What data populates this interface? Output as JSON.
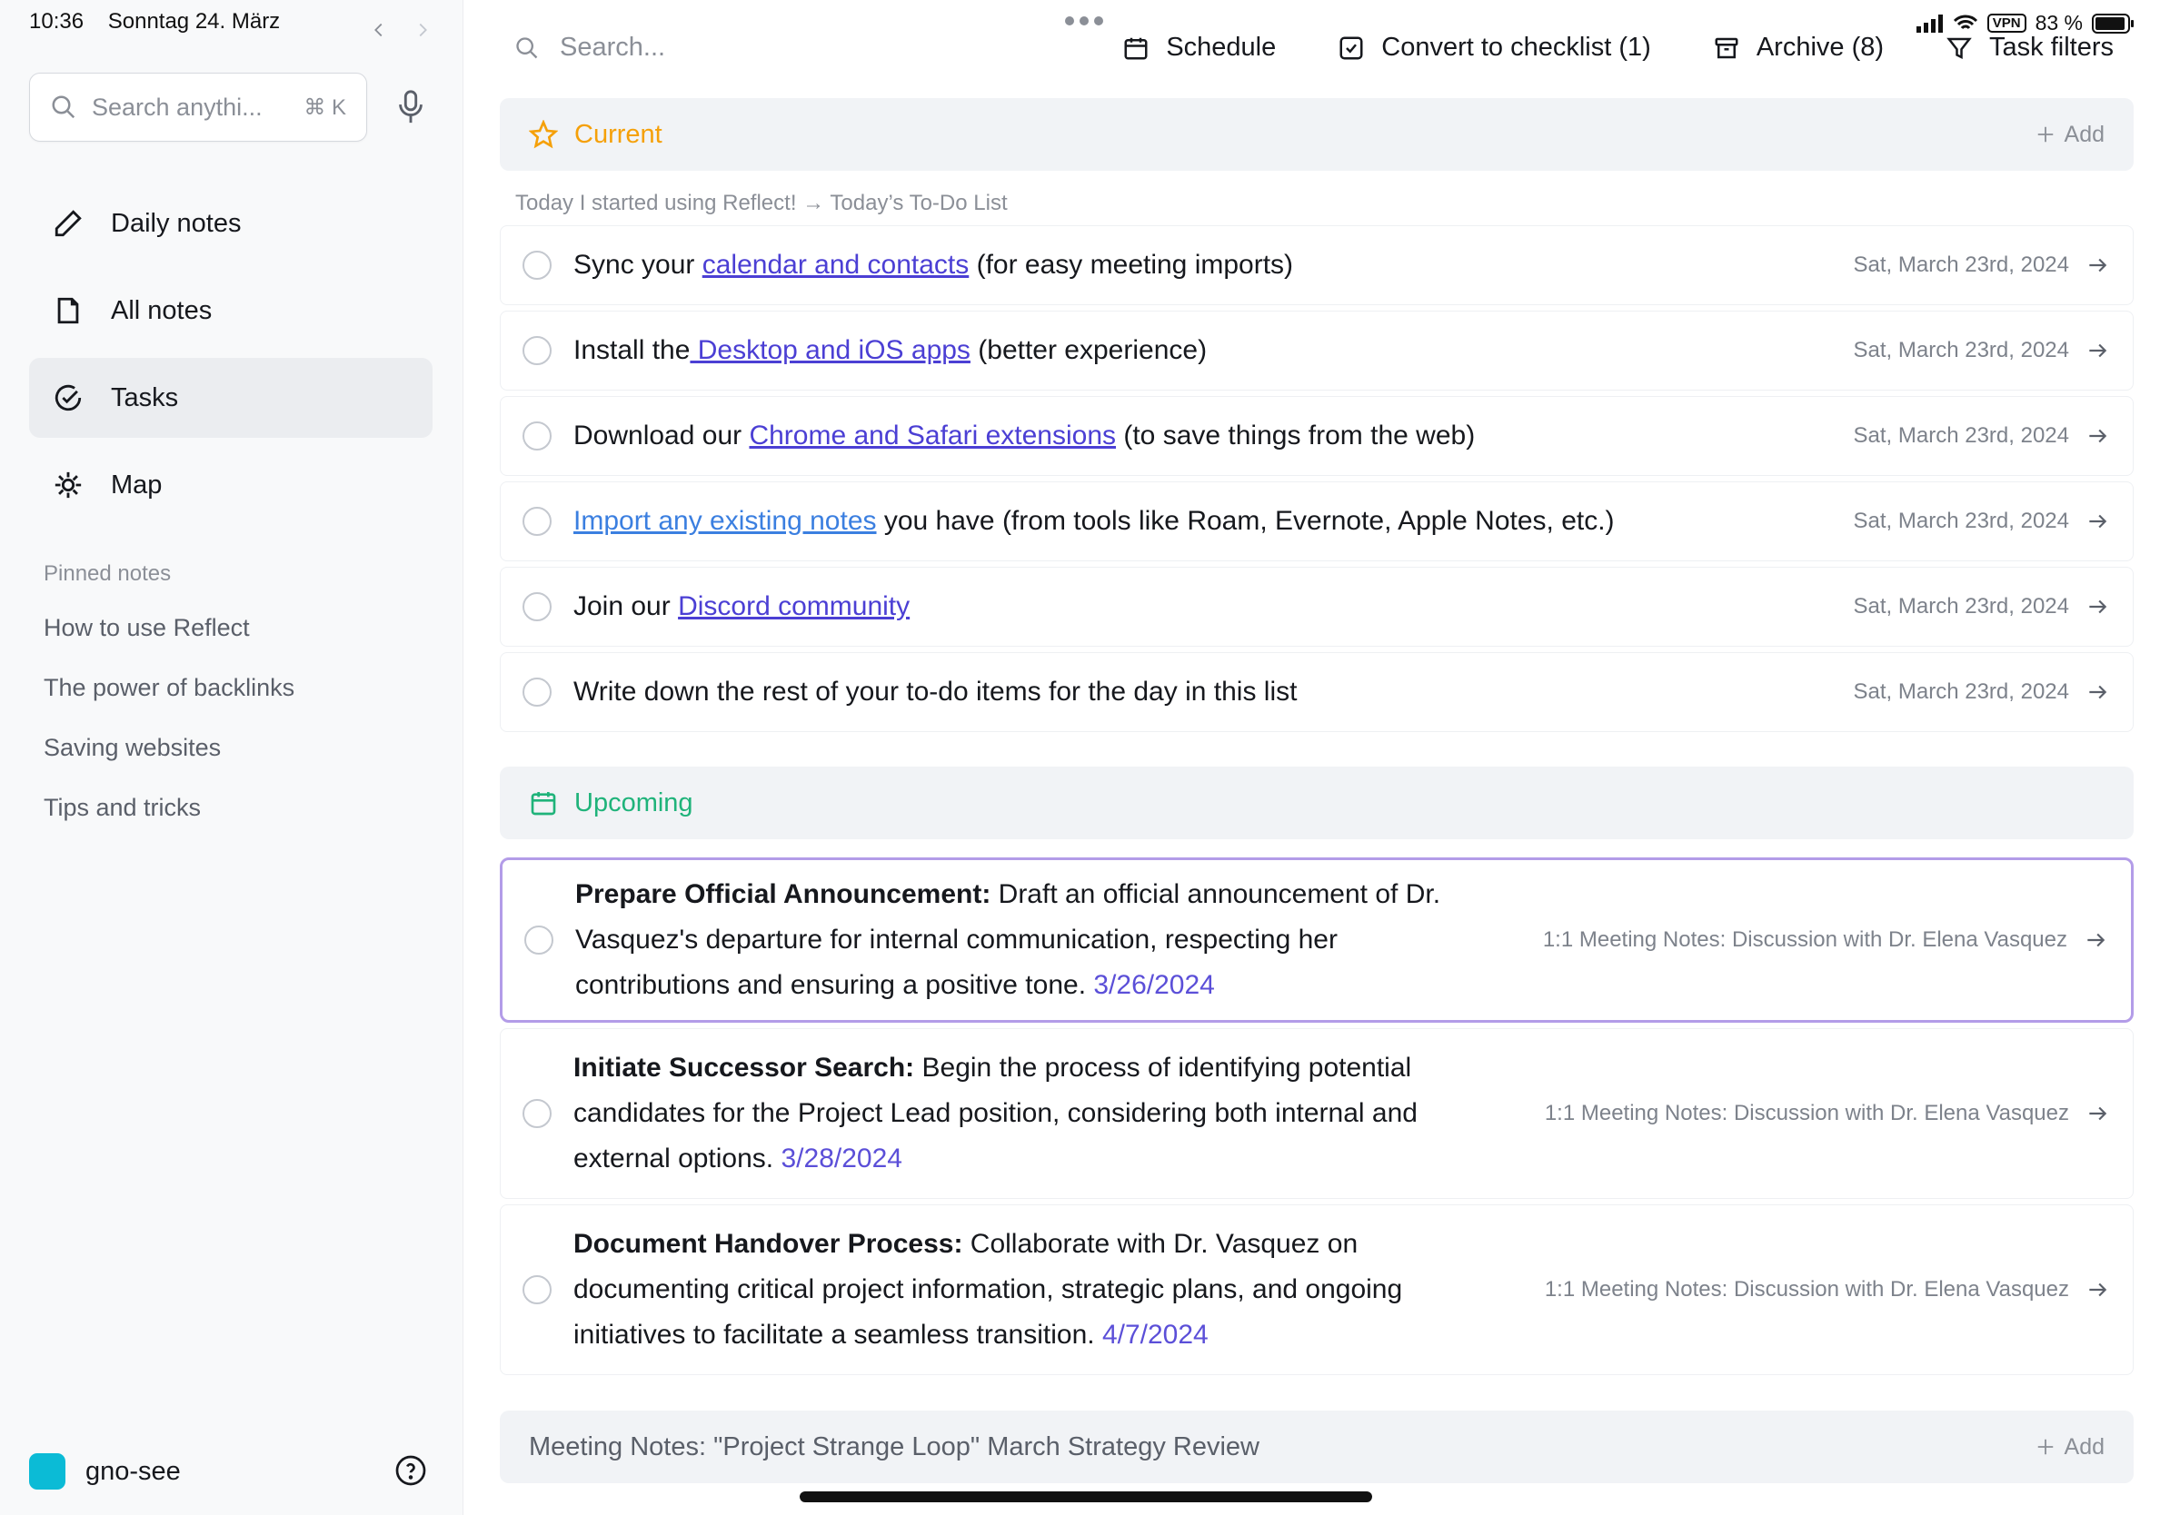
{
  "status_bar": {
    "time": "10:36",
    "date": "Sonntag 24. März",
    "vpn": "VPN",
    "battery": "83 %"
  },
  "sidebar": {
    "search_placeholder": "Search anythi...",
    "search_shortcut": "⌘ K",
    "nav": [
      {
        "label": "Daily notes",
        "icon": "pencil-icon"
      },
      {
        "label": "All notes",
        "icon": "note-icon"
      },
      {
        "label": "Tasks",
        "icon": "check-circle-icon",
        "active": true
      },
      {
        "label": "Map",
        "icon": "map-icon"
      }
    ],
    "pinned_title": "Pinned notes",
    "pinned": [
      "How to use Reflect",
      "The power of backlinks",
      "Saving websites",
      "Tips and tricks"
    ],
    "workspace": "gno-see",
    "workspace_color": "#0bbbd6"
  },
  "toolbar": {
    "search_placeholder": "Search...",
    "schedule": "Schedule",
    "convert": "Convert to checklist (1)",
    "archive": "Archive (8)",
    "filters": "Task filters"
  },
  "current": {
    "title": "Current",
    "add": "Add",
    "color": "#f5a009",
    "breadcrumb": "Today I started using Reflect! → Today’s To-Do List",
    "tasks": [
      {
        "before": "Sync your ",
        "link": "calendar and contacts",
        "after": " (for easy meeting imports)",
        "meta": "Sat, March 23rd, 2024"
      },
      {
        "before": "Install the",
        "link": " Desktop and iOS apps",
        "after": " (better experience)",
        "meta": "Sat, March 23rd, 2024"
      },
      {
        "before": "Download our ",
        "link": "Chrome and Safari extensions",
        "after": " (to save things from the web)",
        "meta": "Sat, March 23rd, 2024"
      },
      {
        "before": "",
        "link": "Import any existing notes",
        "after": " you have (from tools like Roam, Evernote, Apple Notes, etc.)",
        "meta": "Sat, March 23rd, 2024"
      },
      {
        "before": "Join our ",
        "link": "Discord community",
        "after": "",
        "meta": "Sat, March 23rd, 2024"
      },
      {
        "before": "Write down the rest of your to-do items for the day in this list",
        "link": "",
        "after": "",
        "meta": "Sat, March 23rd, 2024"
      }
    ]
  },
  "upcoming": {
    "title": "Upcoming",
    "color": "#1fb37a",
    "tasks": [
      {
        "bold": "Prepare Official Announcement:",
        "text": " Draft an official announcement of Dr. Vasquez's departure for internal communication, respecting her contributions and ensuring a positive tone. ",
        "date": "3/26/2024",
        "meta": "1:1 Meeting Notes: Discussion with Dr. Elena Vasquez"
      },
      {
        "bold": "Initiate Successor Search:",
        "text": " Begin the process of identifying potential candidates for the Project Lead position, considering both internal and external options. ",
        "date": "3/28/2024",
        "meta": "1:1 Meeting Notes: Discussion with Dr. Elena Vasquez"
      },
      {
        "bold": "Document Handover Process:",
        "text": " Collaborate with Dr. Vasquez on documenting critical project information, strategic plans, and ongoing initiatives to facilitate a seamless transition. ",
        "date": "4/7/2024",
        "meta": "1:1 Meeting Notes: Discussion with Dr. Elena Vasquez"
      }
    ]
  },
  "meeting_section": {
    "title": "Meeting Notes: \"Project Strange Loop\" March Strategy Review",
    "add": "Add"
  }
}
